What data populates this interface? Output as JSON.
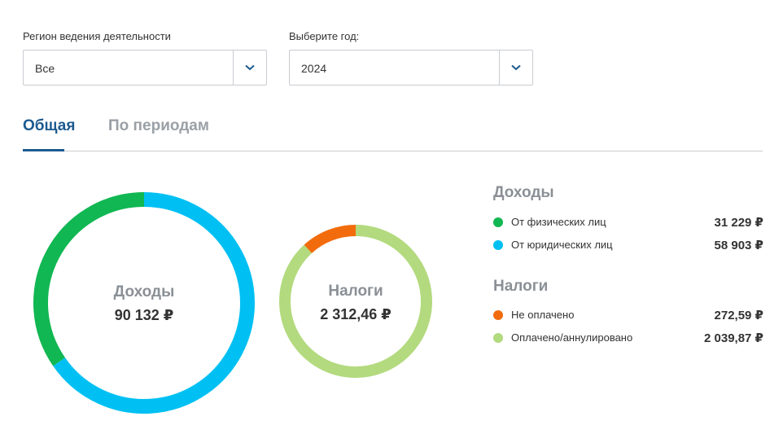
{
  "filters": {
    "region": {
      "label": "Регион ведения деятельности",
      "value": "Все"
    },
    "year": {
      "label": "Выберите год:",
      "value": "2024"
    },
    "chevron_icon": "chevron-down-icon",
    "chevron_color": "#1c5a8f"
  },
  "tabs": [
    {
      "label": "Общая",
      "active": true
    },
    {
      "label": "По периодам",
      "active": false
    }
  ],
  "colors": {
    "individuals": "#11b752",
    "legal": "#00c0f3",
    "unpaid": "#f26c0d",
    "paid": "#b3da7e"
  },
  "legend": {
    "income_title": "Доходы",
    "taxes_title": "Налоги",
    "income_items": [
      {
        "label": "От физических лиц",
        "amount": "31 229 ₽"
      },
      {
        "label": "От юридических лиц",
        "amount": "58 903 ₽"
      }
    ],
    "tax_items": [
      {
        "label": "Не оплачено",
        "amount": "272,59 ₽"
      },
      {
        "label": "Оплачено/аннулировано",
        "amount": "2 039,87 ₽"
      }
    ]
  },
  "chart_data": [
    {
      "type": "pie",
      "title": "Доходы",
      "total_label": "90 132 ₽",
      "categories": [
        "От физических лиц",
        "От юридических лиц"
      ],
      "values": [
        31229,
        58903
      ],
      "colors": [
        "#11b752",
        "#00c0f3"
      ]
    },
    {
      "type": "pie",
      "title": "Налоги",
      "total_label": "2 312,46 ₽",
      "categories": [
        "Не оплачено",
        "Оплачено/аннулировано"
      ],
      "values": [
        272.59,
        2039.87
      ],
      "colors": [
        "#f26c0d",
        "#b3da7e"
      ]
    }
  ]
}
